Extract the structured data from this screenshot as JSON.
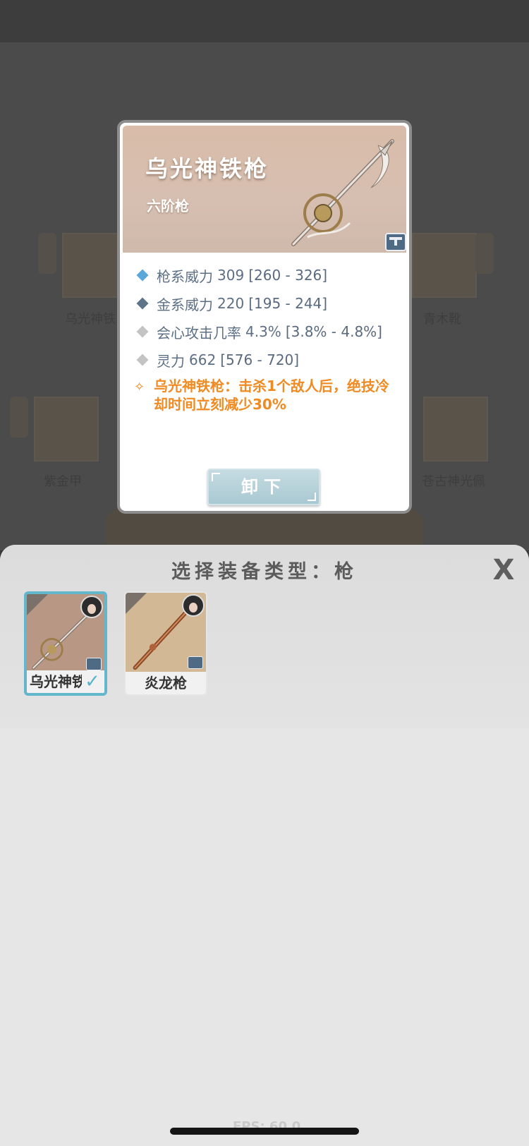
{
  "background": {
    "left_labels": [
      "乌光神铁",
      "紫金甲"
    ],
    "right_labels": [
      "青木靴",
      "苍古神光佩"
    ]
  },
  "popup": {
    "title": "乌光神铁枪",
    "subtitle": "六阶枪",
    "stats": [
      {
        "name": "枪系威力",
        "value": "309",
        "range": "[260 - 326]",
        "color": "#5aa7d9"
      },
      {
        "name": "金系威力",
        "value": "220",
        "range": "[195 - 244]",
        "color": "#5e7488"
      },
      {
        "name": "会心攻击几率",
        "value": "4.3%",
        "range": "[3.8% - 4.8%]",
        "color": "#c4c4c4"
      },
      {
        "name": "灵力",
        "value": "662",
        "range": "[576 - 720]",
        "color": "#c4c4c4"
      }
    ],
    "special_effect": "乌光神铁枪：击杀1个敌人后，绝技冷却时间立刻减少30%",
    "unequip_label": "卸下",
    "lock_icon": "lock-icon"
  },
  "sheet": {
    "title": "选择装备类型：枪",
    "close_label": "X",
    "items": [
      {
        "name": "乌光神铁",
        "selected": true,
        "check": "✓"
      },
      {
        "name": "炎龙枪",
        "selected": false
      }
    ]
  },
  "fps_text": "FPS: 60.0",
  "colors": {
    "accent_blue": "#64b6cd",
    "special_orange": "#f08a23",
    "stat_text": "#5d6f84"
  }
}
